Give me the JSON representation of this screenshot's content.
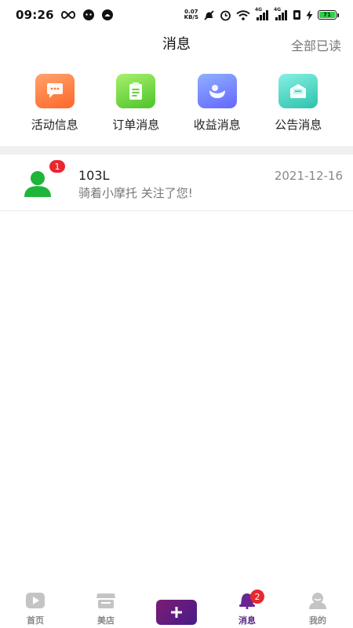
{
  "status_bar": {
    "time": "09:26",
    "speed_value": "0.07",
    "speed_unit": "KB/S",
    "network_1": "4G",
    "network_2": "4G",
    "battery": "71"
  },
  "header": {
    "title": "消息",
    "mark_all_read": "全部已读"
  },
  "categories": [
    {
      "label": "活动信息",
      "icon": "chat-bubble-icon",
      "color_from": "#ffa06a",
      "color_to": "#ff6a2e"
    },
    {
      "label": "订单消息",
      "icon": "clipboard-icon",
      "color_from": "#a5f06a",
      "color_to": "#4fc52e"
    },
    {
      "label": "收益消息",
      "icon": "wallet-icon",
      "color_from": "#8aa8ff",
      "color_to": "#6a6aff"
    },
    {
      "label": "公告消息",
      "icon": "envelope-icon",
      "color_from": "#7ff0e0",
      "color_to": "#2ec5b0"
    }
  ],
  "messages": [
    {
      "name": "103L",
      "date": "2021-12-16",
      "text": "骑着小摩托 关注了您!",
      "unread": "1"
    }
  ],
  "bottom_nav": {
    "home": "首页",
    "store": "美店",
    "messages": "消息",
    "messages_badge": "2",
    "mine": "我的"
  },
  "colors": {
    "accent": "#5b2a86",
    "badge": "#e8282e",
    "avatar_green": "#20b83a"
  }
}
